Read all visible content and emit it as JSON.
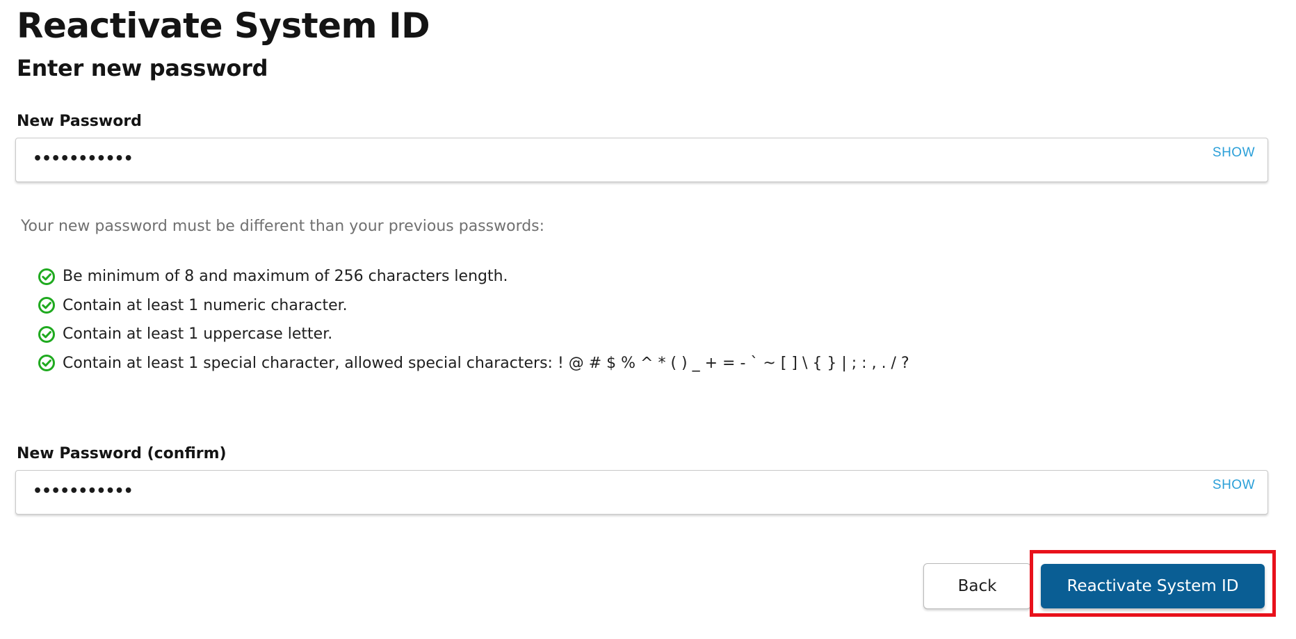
{
  "page": {
    "title": "Reactivate System ID",
    "subtitle": "Enter new password"
  },
  "new_password": {
    "label": "New Password",
    "value": "•••••••••••",
    "show_label": "SHOW"
  },
  "requirements": {
    "intro": "Your new password must be different than your previous passwords:",
    "items": [
      {
        "text": "Be minimum of 8 and maximum of 256 characters length.",
        "met": true,
        "icon": "check-circle-icon"
      },
      {
        "text": "Contain at least 1 numeric character.",
        "met": true,
        "icon": "check-circle-icon"
      },
      {
        "text": "Contain at least 1 uppercase letter.",
        "met": true,
        "icon": "check-circle-icon"
      },
      {
        "text": "Contain at least 1 special character, allowed special characters: ! @ # $ % ^ * ( ) _ + = - ` ~ [ ] \\ { } | ; : , . / ?",
        "met": true,
        "icon": "check-circle-icon"
      }
    ]
  },
  "confirm_password": {
    "label": "New Password (confirm)",
    "value": "•••••••••••",
    "show_label": "SHOW"
  },
  "actions": {
    "back_label": "Back",
    "submit_label": "Reactivate System ID"
  },
  "colors": {
    "primary": "#0a5e94",
    "link": "#2a9fd8",
    "success": "#1faa1f",
    "highlight": "#e8111b"
  }
}
